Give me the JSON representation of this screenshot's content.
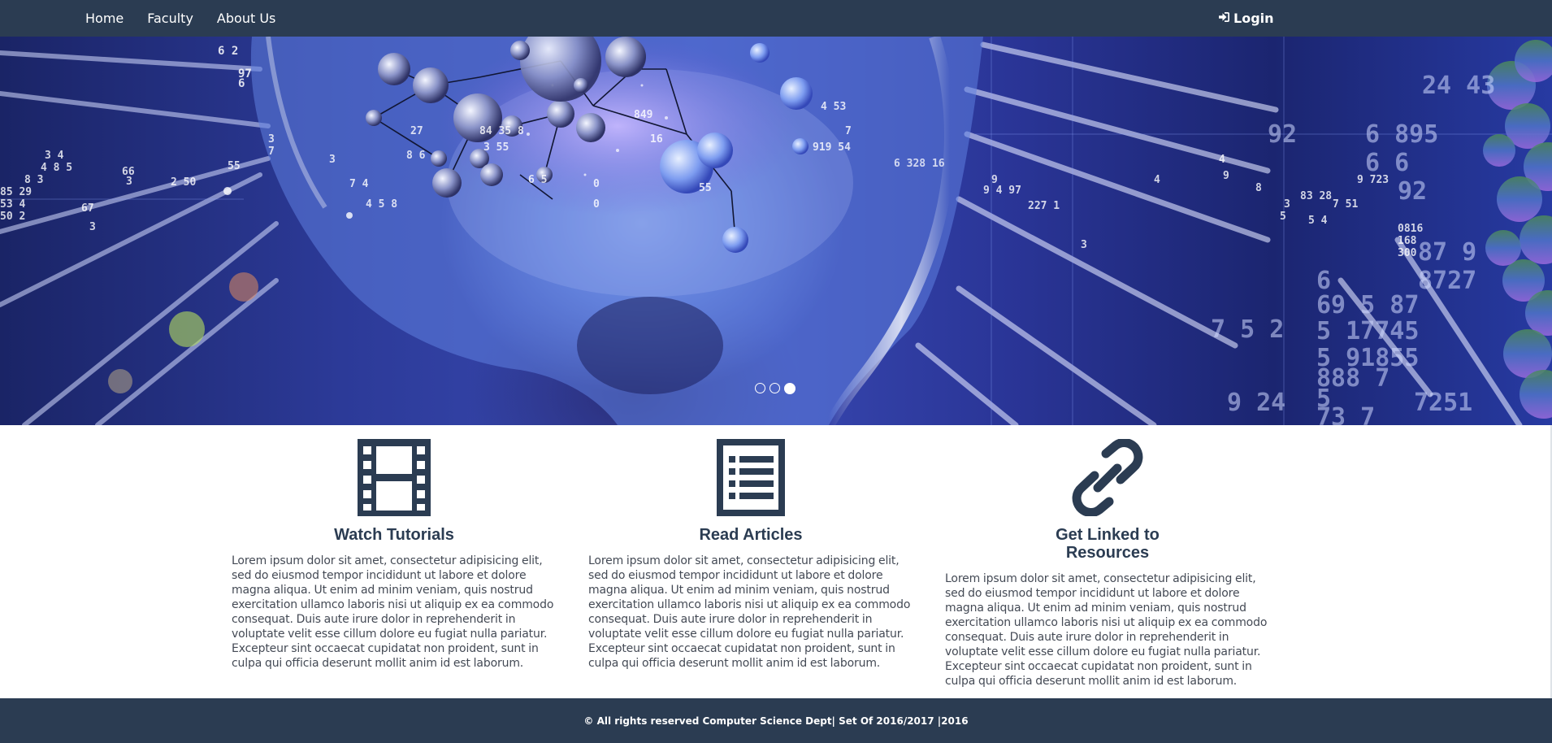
{
  "nav": {
    "links": [
      {
        "label": "Home"
      },
      {
        "label": "Faculty"
      },
      {
        "label": "About Us"
      }
    ],
    "login_label": "Login",
    "login_icon": "sign-in-icon"
  },
  "hero": {
    "active_slide": 3,
    "slide_count": 3
  },
  "features": [
    {
      "icon": "film-icon",
      "title": "Watch Tutorials",
      "text": "Lorem ipsum dolor sit amet, consectetur adipisicing elit, sed do eiusmod tempor incididunt ut labore et dolore magna aliqua. Ut enim ad minim veniam, quis nostrud exercitation ullamco laboris nisi ut aliquip ex ea commodo consequat. Duis aute irure dolor in reprehenderit in voluptate velit esse cillum dolore eu fugiat nulla pariatur. Excepteur sint occaecat cupidatat non proident, sunt in culpa qui officia deserunt mollit anim id est laborum."
    },
    {
      "icon": "list-alt-icon",
      "title": "Read Articles",
      "text": "Lorem ipsum dolor sit amet, consectetur adipisicing elit, sed do eiusmod tempor incididunt ut labore et dolore magna aliqua. Ut enim ad minim veniam, quis nostrud exercitation ullamco laboris nisi ut aliquip ex ea commodo consequat. Duis aute irure dolor in reprehenderit in voluptate velit esse cillum dolore eu fugiat nulla pariatur. Excepteur sint occaecat cupidatat non proident, sunt in culpa qui officia deserunt mollit anim id est laborum."
    },
    {
      "icon": "link-icon",
      "title": "Get Linked to Resources",
      "text": "Lorem ipsum dolor sit amet, consectetur adipisicing elit, sed do eiusmod tempor incididunt ut labore et dolore magna aliqua. Ut enim ad minim veniam, quis nostrud exercitation ullamco laboris nisi ut aliquip ex ea commodo consequat. Duis aute irure dolor in reprehenderit in voluptate velit esse cillum dolore eu fugiat nulla pariatur. Excepteur sint occaecat cupidatat non proident, sunt in culpa qui officia deserunt mollit anim id est laborum."
    }
  ],
  "footer": {
    "text": "© All rights reserved Computer Science Dept| Set Of 2016/2017 |2016"
  },
  "colors": {
    "navbar": "#2b3c52",
    "icon": "#2b3c52",
    "body_text": "#444a55"
  }
}
